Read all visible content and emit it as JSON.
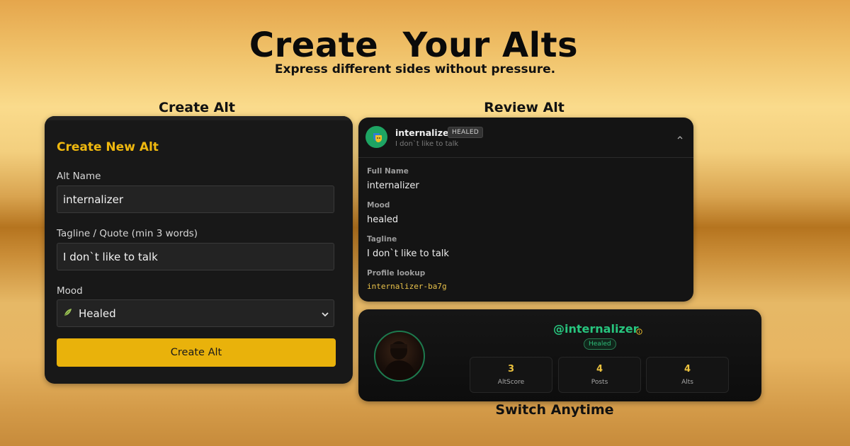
{
  "hero": {
    "title": "Create  Your Alts",
    "subtitle": "Express different sides without pressure."
  },
  "sections": {
    "create": "Create Alt",
    "review": "Review Alt",
    "switch": "Switch Anytime"
  },
  "create_form": {
    "heading": "Create New Alt",
    "name_label": "Alt Name",
    "name_value": "internalizer",
    "tagline_label": "Tagline / Quote (min 3 words)",
    "tagline_value": "I don`t like to talk",
    "mood_label": "Mood",
    "mood_icon": "leaf-icon",
    "mood_value": "Healed",
    "submit_label": "Create Alt"
  },
  "review": {
    "name": "internalizer",
    "badge": "HEALED",
    "tagline_preview": "I don`t like to talk",
    "fields": [
      {
        "label": "Full Name",
        "value": "internalizer"
      },
      {
        "label": "Mood",
        "value": "healed"
      },
      {
        "label": "Tagline",
        "value": "I don`t like to talk"
      },
      {
        "label": "Profile lookup",
        "value": "internalizer-ba7g"
      }
    ]
  },
  "profile": {
    "handle": "@internalizer",
    "mood_badge": "Healed",
    "stats": [
      {
        "value": "3",
        "label": "AltScore"
      },
      {
        "value": "4",
        "label": "Posts"
      },
      {
        "value": "4",
        "label": "Alts"
      }
    ]
  },
  "colors": {
    "accent": "#e9b20b",
    "heading_gold": "#efb80f",
    "handle_green": "#27c57e",
    "panel_bg": "#181818"
  }
}
